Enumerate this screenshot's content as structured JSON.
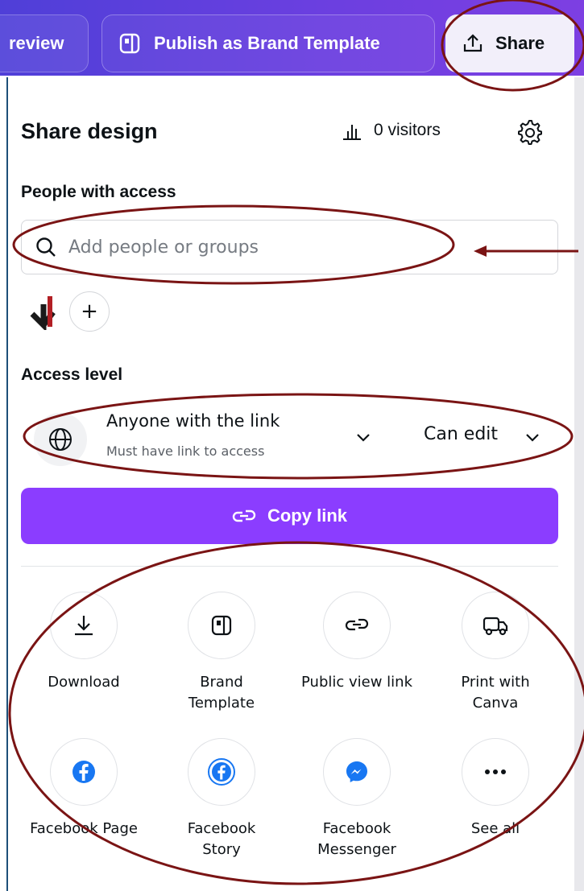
{
  "topbar": {
    "preview_label": "review",
    "publish_label": "Publish as Brand Template",
    "share_label": "Share"
  },
  "panel": {
    "title": "Share design",
    "visitors": "0 visitors"
  },
  "people": {
    "heading": "People with access",
    "search_placeholder": "Add people or groups",
    "add_symbol": "+"
  },
  "access": {
    "heading": "Access level",
    "scope": "Anyone with the link",
    "scope_sub": "Must have link to access",
    "permission": "Can edit"
  },
  "copy_link": {
    "label": "Copy link"
  },
  "options": [
    {
      "label": "Download",
      "icon": "download-icon"
    },
    {
      "label": "Brand Template",
      "icon": "brand-template-icon"
    },
    {
      "label": "Public view link",
      "icon": "link-icon"
    },
    {
      "label": "Print with Canva",
      "icon": "truck-icon"
    },
    {
      "label": "Facebook Page",
      "icon": "facebook-icon"
    },
    {
      "label": "Facebook Story",
      "icon": "facebook-story-icon"
    },
    {
      "label": "Facebook Messenger",
      "icon": "messenger-icon"
    },
    {
      "label": "See all",
      "icon": "more-icon"
    }
  ],
  "colors": {
    "topbar": "#5b3fdc",
    "accent": "#8b3dff",
    "annotation": "#7a1414",
    "facebook": "#1877f2"
  }
}
